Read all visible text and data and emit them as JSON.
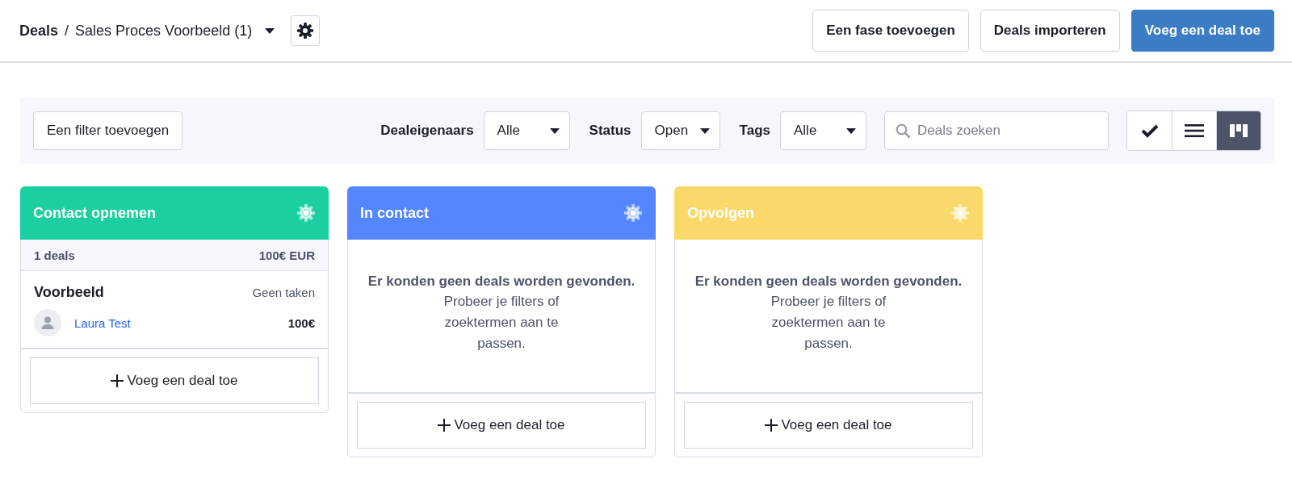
{
  "breadcrumb": {
    "root": "Deals",
    "separator": "/",
    "pipeline": "Sales Proces Voorbeeld (1)"
  },
  "header_buttons": [
    {
      "label": "Een fase toevoegen",
      "kind": "secondary"
    },
    {
      "label": "Deals importeren",
      "kind": "secondary"
    },
    {
      "label": "Voeg een deal toe",
      "kind": "primary"
    }
  ],
  "filters": {
    "add_filter": "Een filter toevoegen",
    "dropdowns": [
      {
        "label": "Dealeigenaars",
        "value": "Alle",
        "kind": "wide"
      },
      {
        "label": "Status",
        "value": "Open",
        "kind": "compact"
      },
      {
        "label": "Tags",
        "value": "Alle",
        "kind": "wide"
      }
    ],
    "search": {
      "placeholder": "Deals zoeken"
    },
    "views": [
      {
        "kind": "check",
        "selected": false
      },
      {
        "kind": "list",
        "selected": false
      },
      {
        "kind": "board",
        "selected": true
      }
    ]
  },
  "columns": [
    {
      "title": "Contact opnemen",
      "color": "#1ccfa0",
      "summary": {
        "count": "1 deals",
        "total": "100€ EUR"
      },
      "deals": [
        {
          "title": "Voorbeeld",
          "tasks": "Geen taken",
          "owner": "Laura Test",
          "amount": "100€"
        }
      ],
      "add_label": "Voeg een deal toe"
    },
    {
      "title": "In contact",
      "color": "#5486ff",
      "empty": {
        "title": "Er konden geen deals worden gevonden.",
        "hint": "Probeer je filters of zoektermen aan te passen."
      },
      "add_label": "Voeg een deal toe"
    },
    {
      "title": "Opvolgen",
      "color": "#fad96a",
      "empty": {
        "title": "Er konden geen deals worden gevonden.",
        "hint": "Probeer je filters of zoektermen aan te passen."
      },
      "add_label": "Voeg een deal toe"
    }
  ]
}
